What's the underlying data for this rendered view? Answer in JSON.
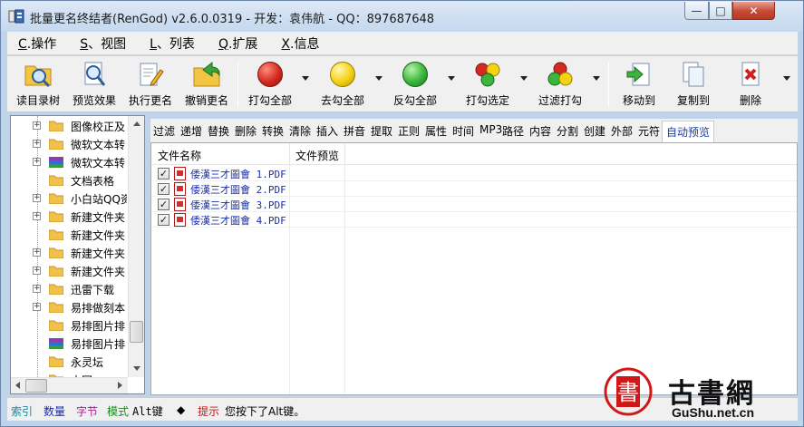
{
  "window": {
    "title": "批量更名终结者(RenGod) v2.6.0.0319 - 开发：袁伟航 - QQ：897687648",
    "controls": {
      "minimize": "—",
      "maximize": "□",
      "close": "✕"
    }
  },
  "menu": [
    {
      "key": "C",
      "label": ".操作"
    },
    {
      "key": "S",
      "label": "、视图"
    },
    {
      "key": "L",
      "label": "、列表"
    },
    {
      "key": "Q",
      "label": ".扩展"
    },
    {
      "key": "X",
      "label": ".信息"
    }
  ],
  "toolbar": [
    {
      "label": "读目录树",
      "icon": "folder-search-icon"
    },
    {
      "label": "预览效果",
      "icon": "magnifier-icon"
    },
    {
      "label": "执行更名",
      "icon": "document-pencil-icon"
    },
    {
      "label": "撤销更名",
      "icon": "folder-undo-icon"
    },
    {
      "label": "打勾全部",
      "icon": "red-circle-icon",
      "color": "#d42a1f"
    },
    {
      "label": "去勾全部",
      "icon": "yellow-circle-icon",
      "color": "#f4d214"
    },
    {
      "label": "反勾全部",
      "icon": "green-circle-icon",
      "color": "#3bb53b"
    },
    {
      "label": "打勾选定",
      "icon": "traffic-circles-icon"
    },
    {
      "label": "过滤打勾",
      "icon": "filter-circles-icon"
    },
    {
      "label": "移动到",
      "icon": "move-to-icon"
    },
    {
      "label": "复制到",
      "icon": "copy-to-icon"
    },
    {
      "label": "删除",
      "icon": "delete-icon"
    }
  ],
  "tree": [
    {
      "label": "图像校正及",
      "expandable": true,
      "icon": "folder-icon"
    },
    {
      "label": "微软文本转",
      "expandable": true,
      "icon": "folder-icon"
    },
    {
      "label": "微软文本转",
      "expandable": true,
      "icon": "archive-icon"
    },
    {
      "label": "文档表格",
      "expandable": false,
      "icon": "folder-icon"
    },
    {
      "label": "小白站QQ资",
      "expandable": true,
      "icon": "folder-icon"
    },
    {
      "label": "新建文件夹",
      "expandable": true,
      "icon": "folder-icon"
    },
    {
      "label": "新建文件夹",
      "expandable": false,
      "icon": "folder-icon"
    },
    {
      "label": "新建文件夹",
      "expandable": true,
      "icon": "folder-icon"
    },
    {
      "label": "新建文件夹",
      "expandable": true,
      "icon": "folder-icon"
    },
    {
      "label": "迅雷下载",
      "expandable": true,
      "icon": "folder-icon"
    },
    {
      "label": "易排做刻本",
      "expandable": true,
      "icon": "folder-icon"
    },
    {
      "label": "易排图片排",
      "expandable": false,
      "icon": "folder-icon"
    },
    {
      "label": "易排图片排",
      "expandable": false,
      "icon": "archive-icon"
    },
    {
      "label": "永灵坛",
      "expandable": false,
      "icon": "folder-icon"
    },
    {
      "label": "中国",
      "expandable": false,
      "icon": "folder-icon"
    }
  ],
  "tabs": [
    "过滤",
    "递增",
    "替换",
    "删除",
    "转换",
    "清除",
    "插入",
    "拼音",
    "提取",
    "正则",
    "属性",
    "时间",
    "MP3",
    "路径",
    "内容",
    "分割",
    "创建",
    "外部",
    "元符",
    "自动预览"
  ],
  "filelist": {
    "columns": [
      "文件名称",
      "文件预览"
    ],
    "rows": [
      {
        "name": "倭漢三才圖會 1.PDF",
        "checked": true,
        "check_mark": "✓"
      },
      {
        "name": "倭漢三才圖會 2.PDF",
        "checked": true,
        "check_mark": "✓"
      },
      {
        "name": "倭漢三才圖會 3.PDF",
        "checked": true,
        "check_mark": "✓"
      },
      {
        "name": "倭漢三才圖會 4.PDF",
        "checked": true,
        "check_mark": "✓"
      }
    ]
  },
  "status": {
    "index": "索引",
    "count": "数量",
    "bytes": "字节",
    "mode": "模式",
    "mode_value": "Alt键",
    "diamond": "◆",
    "tip_label": "提示",
    "tip_text": "您按下了Alt键。"
  },
  "watermark": {
    "logo_char": "書",
    "title": "古書網",
    "url": "GuShu.net.cn"
  },
  "colors": {
    "accent_blue": "#1a2fa8",
    "index_color": "#0e8fa0",
    "count_color": "#1c2e9c",
    "bytes_color": "#b2189e",
    "mode_color": "#1a8a1a",
    "tip_color": "#c01818"
  }
}
